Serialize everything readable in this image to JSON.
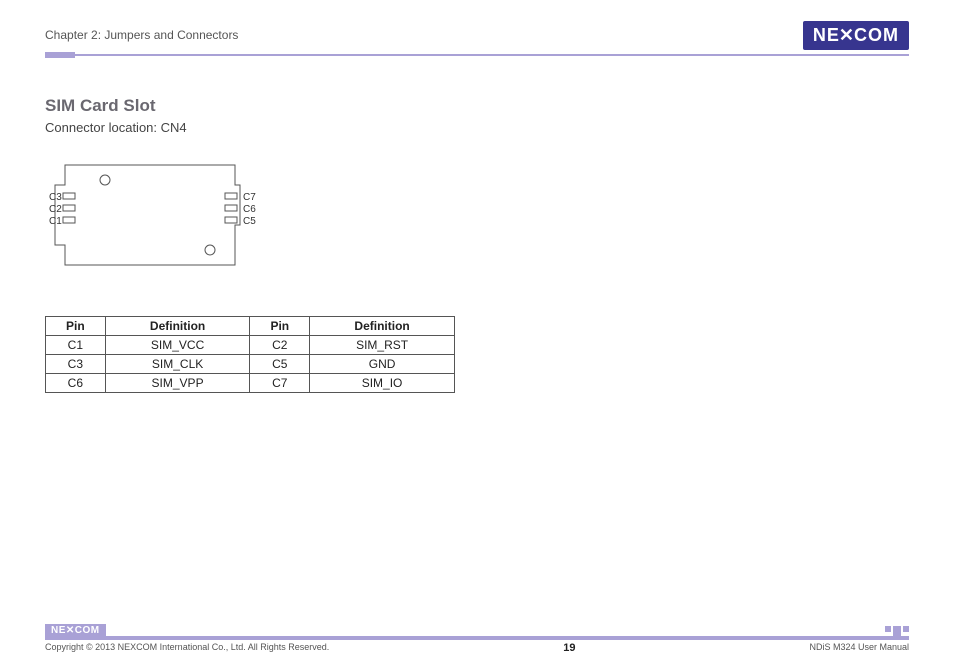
{
  "header": {
    "chapter": "Chapter 2: Jumpers and Connectors",
    "logo_text": "NE COM",
    "logo_x": "X"
  },
  "section": {
    "title": "SIM Card Slot",
    "connector_location": "Connector location: CN4"
  },
  "diagram": {
    "left_labels": [
      "C3",
      "C2",
      "C1"
    ],
    "right_labels": [
      "C7",
      "C6",
      "C5"
    ]
  },
  "table": {
    "headers": {
      "pin": "Pin",
      "definition": "Definition"
    },
    "rows": [
      {
        "pin_a": "C1",
        "def_a": "SIM_VCC",
        "pin_b": "C2",
        "def_b": "SIM_RST"
      },
      {
        "pin_a": "C3",
        "def_a": "SIM_CLK",
        "pin_b": "C5",
        "def_b": "GND"
      },
      {
        "pin_a": "C6",
        "def_a": "SIM_VPP",
        "pin_b": "C7",
        "def_b": "SIM_IO"
      }
    ]
  },
  "footer": {
    "copyright": "Copyright © 2013 NEXCOM International Co., Ltd. All Rights Reserved.",
    "page_number": "19",
    "manual": "NDiS M324 User Manual",
    "small_logo": "NE COM"
  }
}
